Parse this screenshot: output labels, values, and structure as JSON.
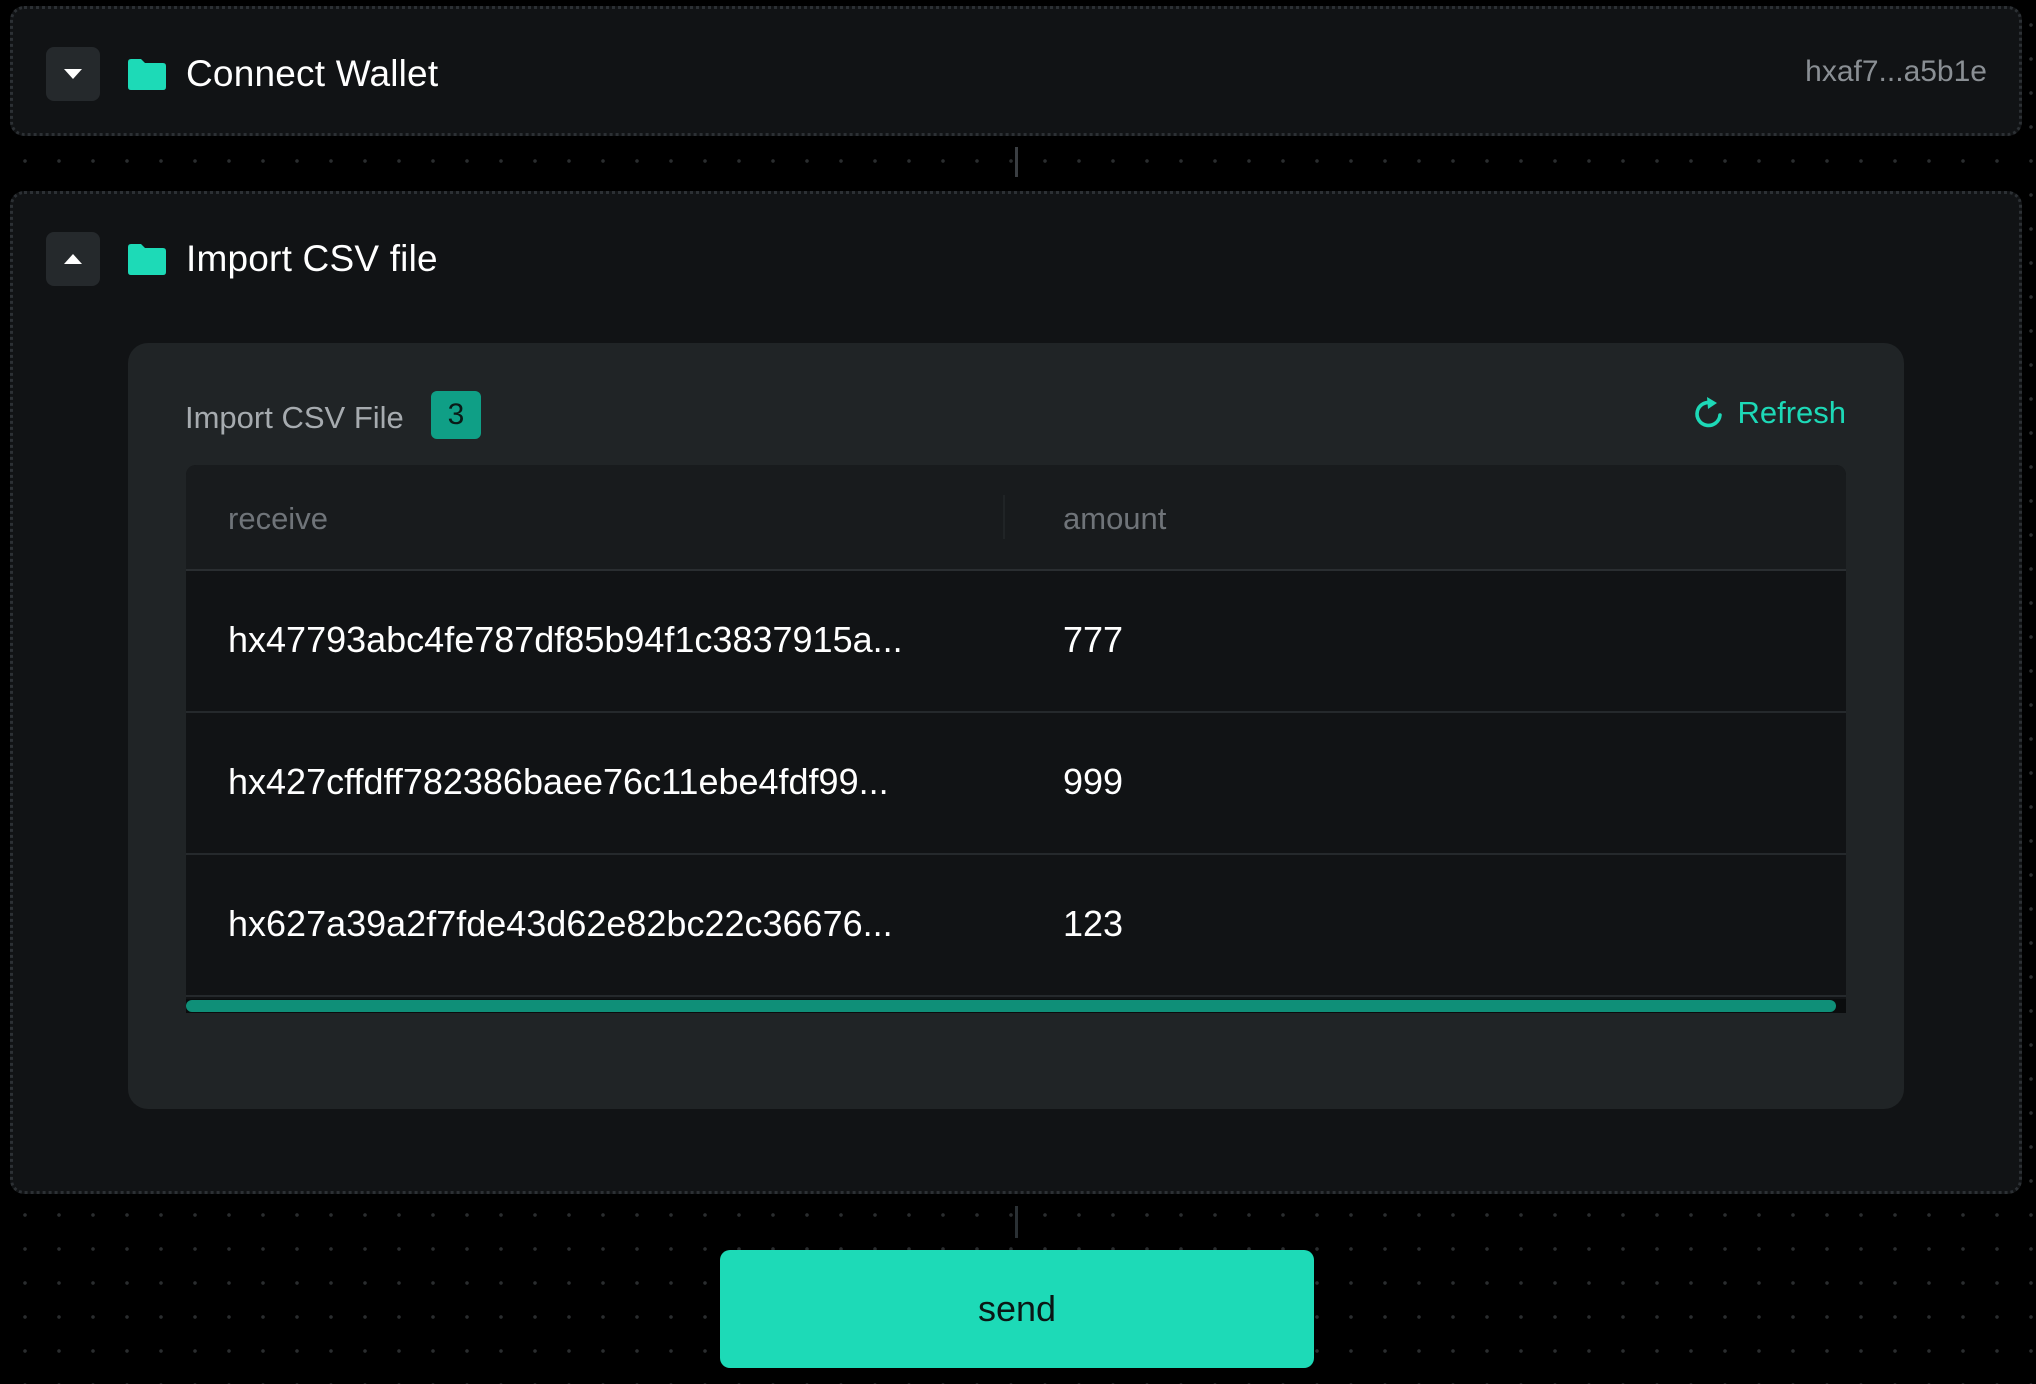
{
  "colors": {
    "accent": "#1ddab7",
    "badge": "#0f9f86",
    "background": "#000000",
    "panel": "#111315",
    "card": "#202426"
  },
  "wallet_step": {
    "title": "Connect Wallet",
    "address": "hxaf7...a5b1e",
    "toggle_icon": "caret-down-icon",
    "folder_icon": "folder-icon"
  },
  "csv_step": {
    "title": "Import CSV file",
    "toggle_icon": "caret-up-icon",
    "folder_icon": "folder-icon",
    "card": {
      "title": "Import CSV File",
      "count": "3",
      "refresh_label": "Refresh",
      "refresh_icon": "refresh-icon",
      "columns": [
        "receive",
        "amount"
      ],
      "rows": [
        {
          "receive": "hx47793abc4fe787df85b94f1c3837915a...",
          "amount": "777"
        },
        {
          "receive": "hx427cffdff782386baee76c11ebe4fdf99...",
          "amount": "999"
        },
        {
          "receive": "hx627a39a2f7fde43d62e82bc22c36676...",
          "amount": "123"
        }
      ]
    }
  },
  "send_label": "send"
}
